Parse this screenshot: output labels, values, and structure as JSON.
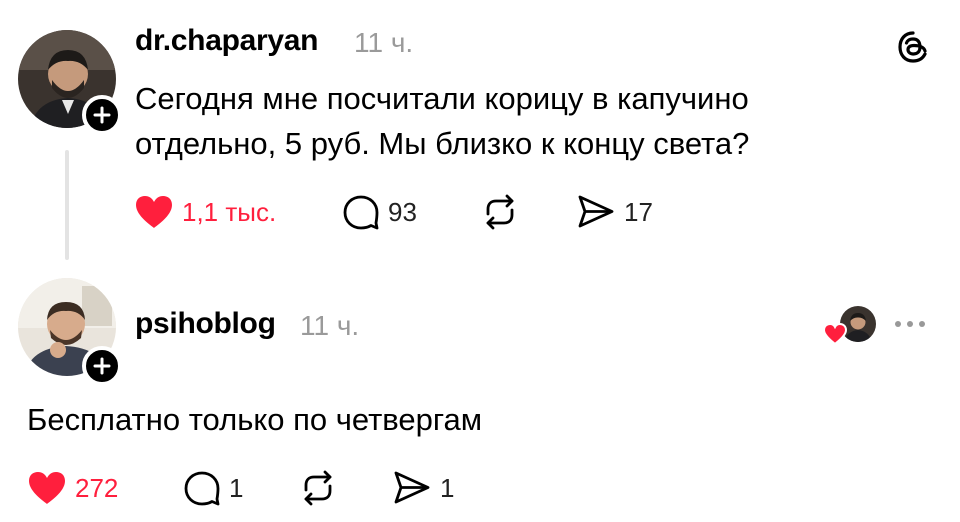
{
  "post": {
    "username": "dr.chaparyan",
    "time": "11 ч.",
    "text_line1": "Сегодня мне посчитали корицу в капучино",
    "text_line2": "отдельно, 5 руб. Мы близко к концу света?",
    "likes": "1,1 тыс.",
    "replies": "93",
    "shares": "17",
    "avatar_icon": "person-photo-avatar",
    "app_icon": "threads-logo-icon",
    "like_color": "#ff1f3d"
  },
  "reply": {
    "username": "psihoblog",
    "time": "11 ч.",
    "text": "Бесплатно только по четвергам",
    "likes": "272",
    "replies": "1",
    "shares": "1",
    "avatar_icon": "person-photo-avatar",
    "liked_by_icon": "author-liked-avatar"
  }
}
